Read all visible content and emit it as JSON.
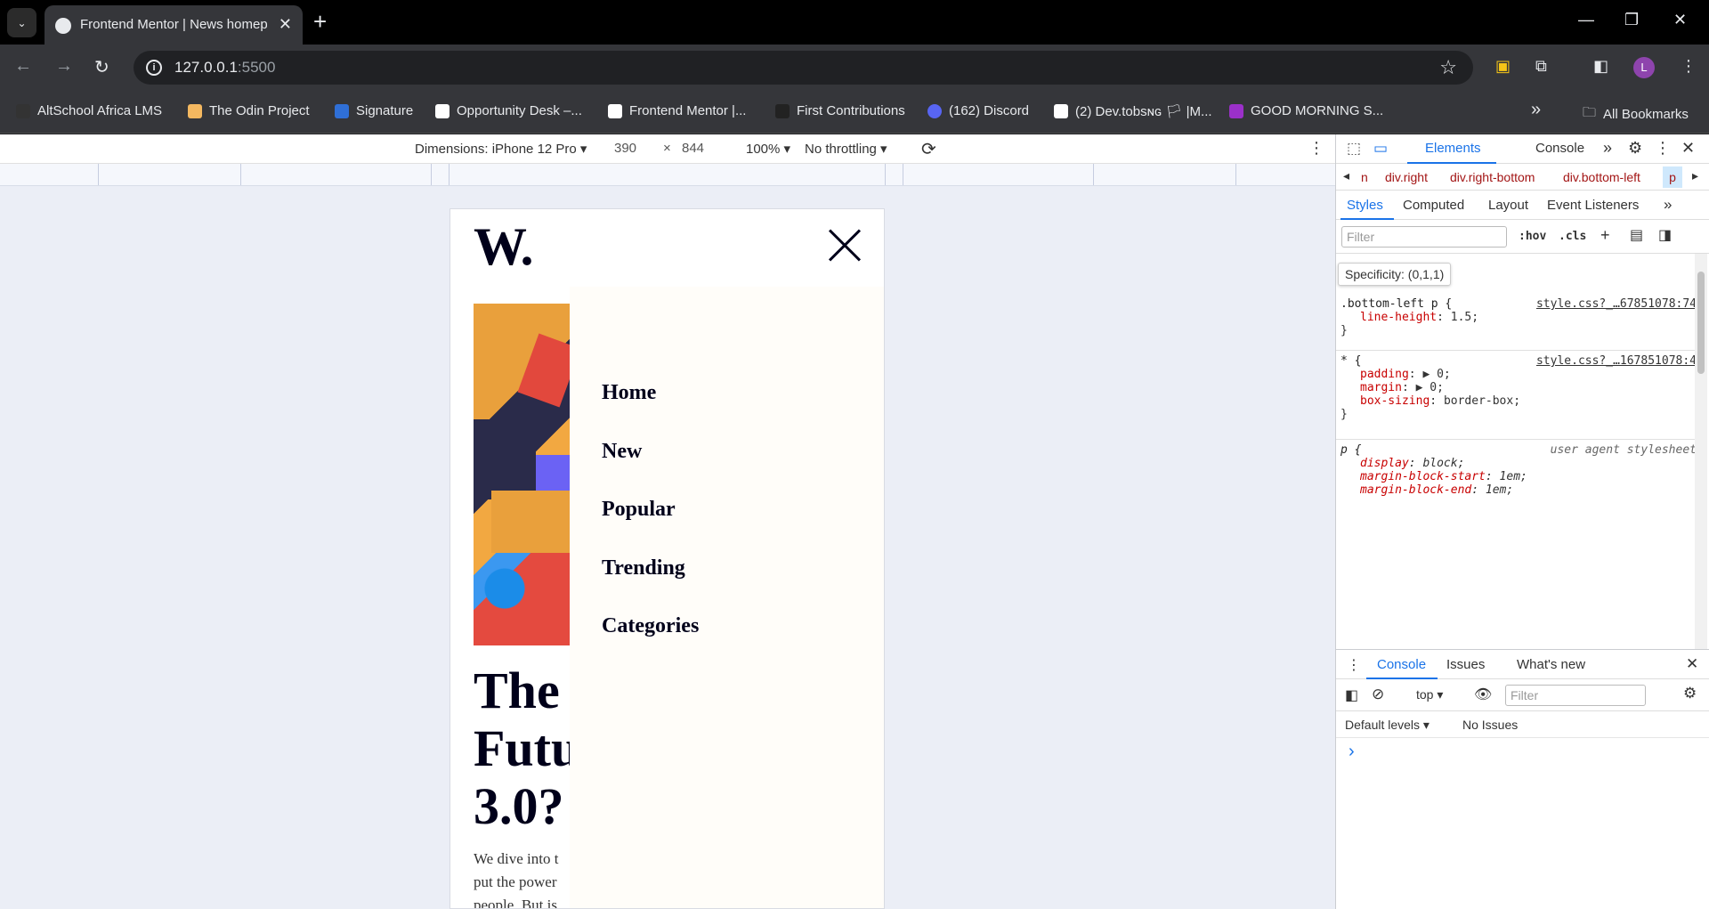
{
  "browser": {
    "tab_title": "Frontend Mentor | News homep",
    "url_host": "127.0.0.1",
    "url_port": ":5500",
    "avatar_letter": "L"
  },
  "bookmarks": [
    {
      "label": "AltSchool Africa LMS",
      "color": "#333333"
    },
    {
      "label": "The Odin Project",
      "color": "#f4b860"
    },
    {
      "label": "Signature",
      "color": "#2f6fd6"
    },
    {
      "label": "Opportunity Desk –...",
      "color": "#ffffff"
    },
    {
      "label": "Frontend Mentor |...",
      "color": "#ffffff"
    },
    {
      "label": "First Contributions",
      "color": "#222222"
    },
    {
      "label": "(162) Discord",
      "color": "#5865f2"
    },
    {
      "label": "(2) Dev.tobsɴɢ 🏳 |M...",
      "color": "#ffffff"
    },
    {
      "label": "GOOD MORNING S...",
      "color": "#9b30c9"
    }
  ],
  "bookmarks_all": "All Bookmarks",
  "device_toolbar": {
    "dimensions": "Dimensions: iPhone 12 Pro",
    "width": "390",
    "times": "×",
    "height": "844",
    "zoom": "100%",
    "throttle": "No throttling"
  },
  "page": {
    "logo": "W.",
    "headline": [
      "The",
      "Futu",
      "3.0?"
    ],
    "description": [
      "We dive into t",
      "put the power",
      "people. But is"
    ],
    "menu": [
      "Home",
      "New",
      "Popular",
      "Trending",
      "Categories"
    ]
  },
  "devtools": {
    "tabs": [
      "Elements",
      "Console"
    ],
    "breadcrumbs": [
      "n",
      "div.right",
      "div.right-bottom",
      "div.bottom-left",
      "p"
    ],
    "subtabs": [
      "Styles",
      "Computed",
      "Layout",
      "Event Listeners"
    ],
    "filter_placeholder": "Filter",
    "hov": ":hov",
    "cls": ".cls",
    "tooltip": "Specificity: (0,1,1)",
    "rules": [
      {
        "selector": ".bottom-left p {",
        "source": "style.css?_…67851078:74",
        "props": [
          [
            "line-height",
            "1.5;"
          ]
        ]
      },
      {
        "selector": "* {",
        "source": "style.css?_…167851078:4",
        "props": [
          [
            "padding",
            "▶ 0;"
          ],
          [
            "margin",
            "▶ 0;"
          ],
          [
            "box-sizing",
            "border-box;"
          ]
        ]
      },
      {
        "selector": "p {",
        "source": "user agent stylesheet",
        "props": [
          [
            "display",
            "block;"
          ],
          [
            "margin-block-start",
            "1em;"
          ],
          [
            "margin-block-end",
            "1em;"
          ]
        ]
      }
    ],
    "drawer_tabs": [
      "Console",
      "Issues",
      "What's new"
    ],
    "context": "top",
    "console_filter": "Filter",
    "levels": "Default levels",
    "no_issues": "No Issues",
    "prompt": "›"
  }
}
